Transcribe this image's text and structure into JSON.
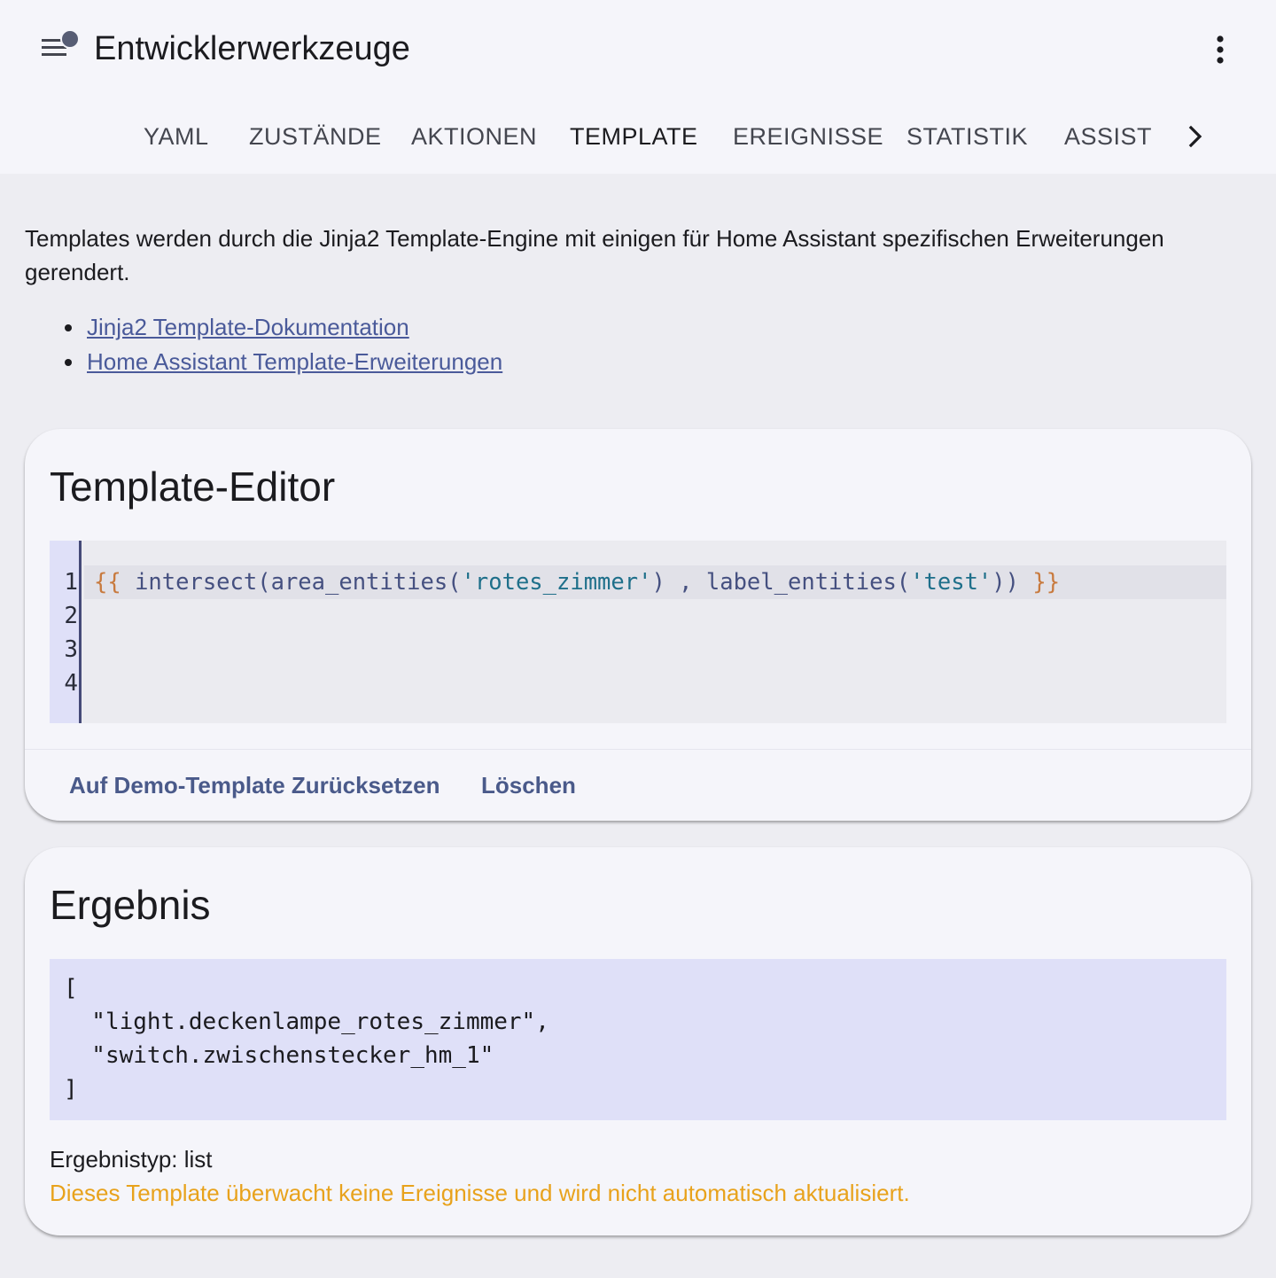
{
  "header": {
    "title": "Entwicklerwerkzeuge",
    "menu_icon": "menu-icon",
    "overflow_icon": "dots-vertical-icon"
  },
  "tabs": [
    {
      "label": "YAML",
      "active": false
    },
    {
      "label": "ZUSTÄNDE",
      "active": false
    },
    {
      "label": "AKTIONEN",
      "active": false
    },
    {
      "label": "TEMPLATE",
      "active": true
    },
    {
      "label": "EREIGNISSE",
      "active": false
    },
    {
      "label": "STATISTIK",
      "active": false
    },
    {
      "label": "ASSIST",
      "active": false
    }
  ],
  "intro": {
    "text": "Templates werden durch die Jinja2 Template-Engine mit einigen für Home Assistant spezifischen Erweiterungen gerendert.",
    "links": [
      "Jinja2 Template-Dokumentation",
      "Home Assistant Template-Erweiterungen"
    ]
  },
  "editor_card": {
    "title": "Template-Editor",
    "line_numbers": [
      "1",
      "2",
      "3",
      "4"
    ],
    "code": {
      "open": "{{",
      "part1": " intersect(area_entities(",
      "str1": "'rotes_zimmer'",
      "part2": ") , label_entities(",
      "str2": "'test'",
      "part3": ")) ",
      "close": "}}"
    },
    "reset_button": "Auf Demo-Template Zurücksetzen",
    "clear_button": "Löschen"
  },
  "result_card": {
    "title": "Ergebnis",
    "output": "[\n  \"light.deckenlampe_rotes_zimmer\",\n  \"switch.zwischenstecker_hm_1\"\n]",
    "type_line": "Ergebnistyp: list",
    "warning": "Dieses Template überwacht keine Ereignisse und wird nicht automatisch aktualisiert."
  },
  "colors": {
    "accent": "#4a5a8a",
    "warning": "#e8a21c",
    "result_background": "#dfe0f8"
  }
}
